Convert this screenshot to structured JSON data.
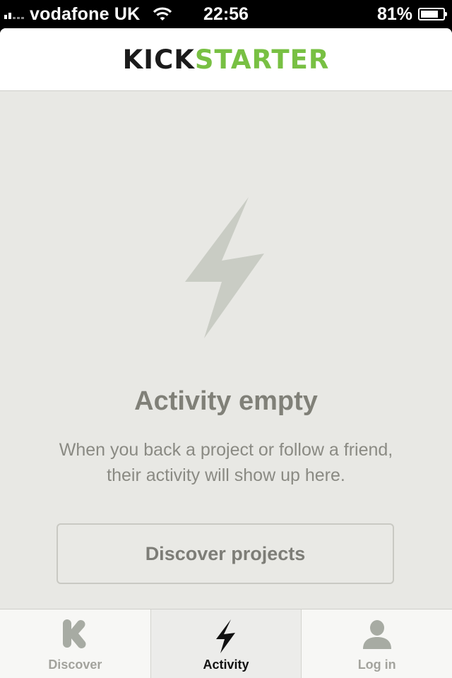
{
  "status_bar": {
    "carrier": "vodafone UK",
    "time": "22:56",
    "battery_percent_text": "81%",
    "battery_level": 0.81
  },
  "app": {
    "logo": {
      "part1": "KICK",
      "part2": "STARTER",
      "part1_color": "#1b1b1b",
      "part2_color": "#78c043"
    }
  },
  "empty_state": {
    "icon": "lightning-bolt-icon",
    "title": "Activity empty",
    "description_line1": "When you back a project or follow a friend,",
    "description_line2": "their activity will show up here.",
    "button_label": "Discover projects"
  },
  "tab_bar": {
    "tabs": [
      {
        "label": "Discover",
        "icon": "kickstarter-k-icon",
        "active": false
      },
      {
        "label": "Activity",
        "icon": "lightning-bolt-icon",
        "active": true
      },
      {
        "label": "Log in",
        "icon": "user-icon",
        "active": false
      }
    ]
  }
}
